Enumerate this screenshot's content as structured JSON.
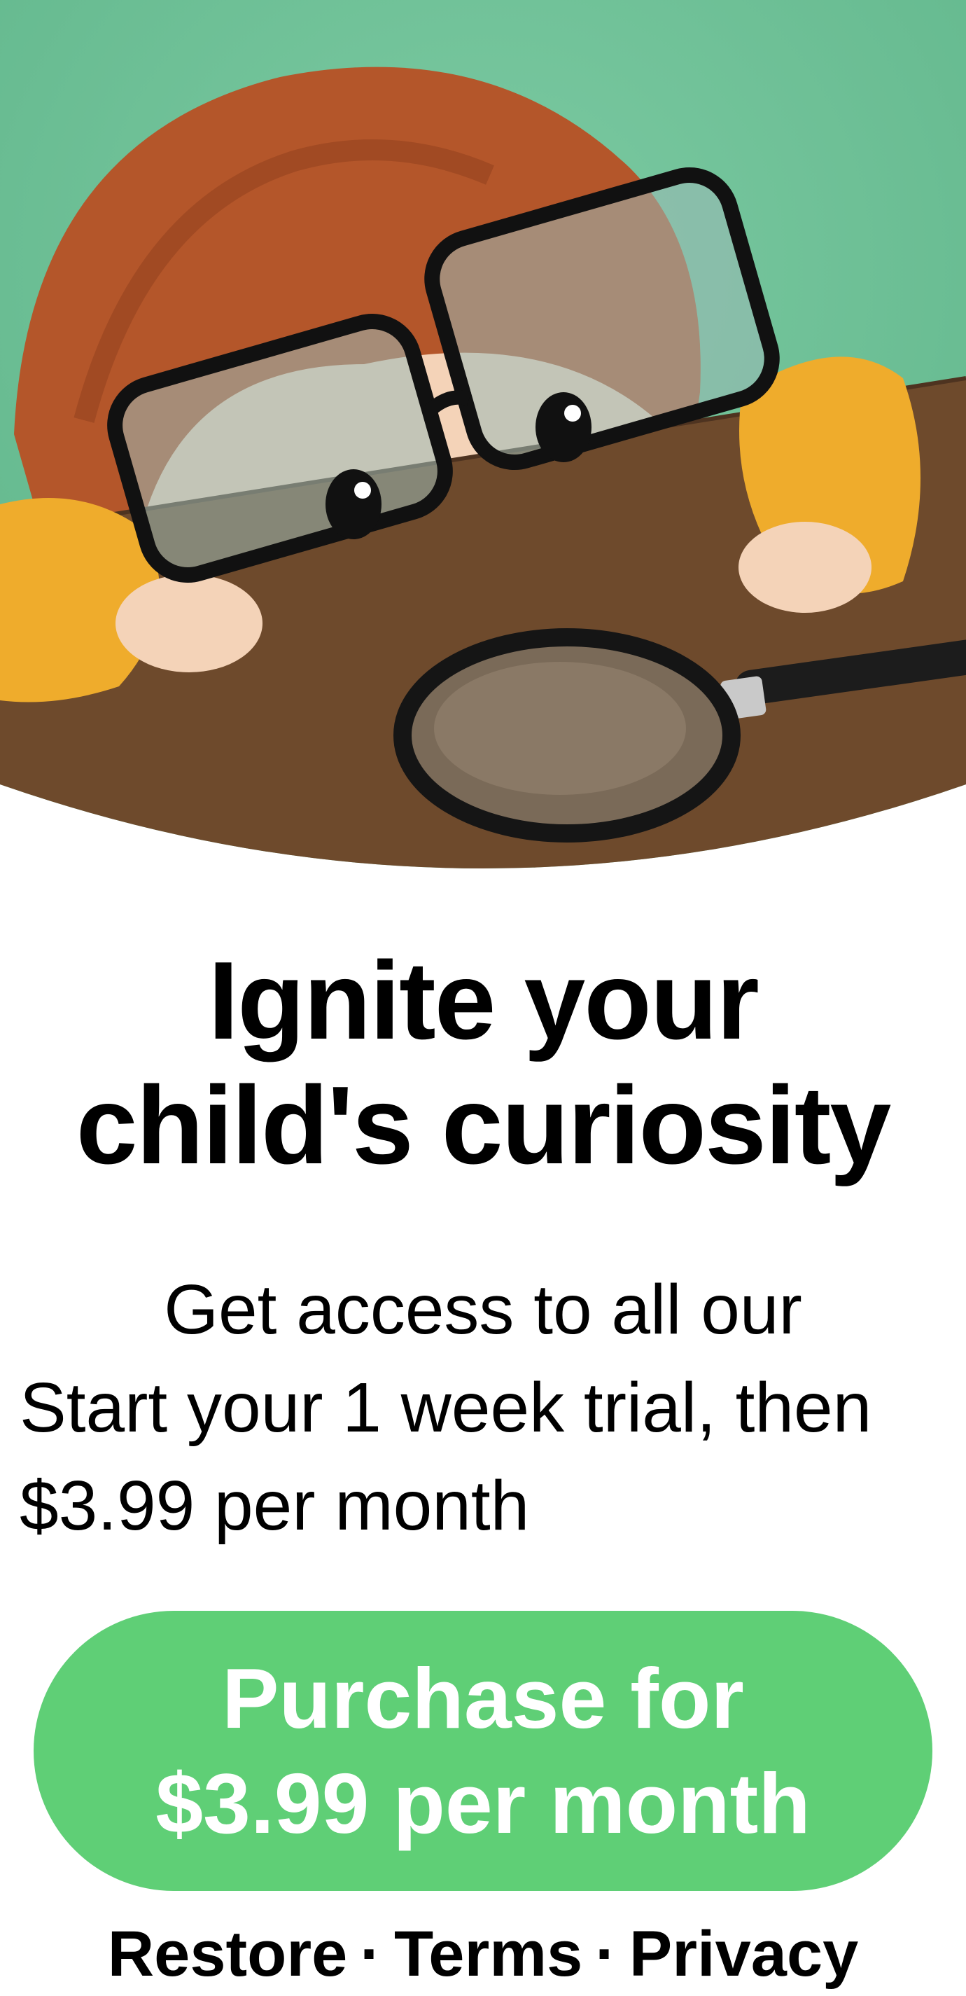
{
  "hero": {
    "image_name": "child-with-magnifying-glass-illustration",
    "colors": {
      "wall": "#6cbf96",
      "table": "#6e4a2c",
      "hair": "#b4562a",
      "sleeves": "#efac2c"
    }
  },
  "headline": {
    "line1": "Ignite your",
    "line2": "child's curiosity"
  },
  "subtitle": "Get access to all our",
  "trial": {
    "line1": "Start your 1 week trial, then",
    "line2": "$3.99 per month"
  },
  "purchase_button": {
    "line1": "Purchase for",
    "line2": "$3.99 per month",
    "color": "#5fcf76"
  },
  "footer": {
    "restore": "Restore",
    "separator": "·",
    "terms": "Terms",
    "privacy": "Privacy"
  }
}
